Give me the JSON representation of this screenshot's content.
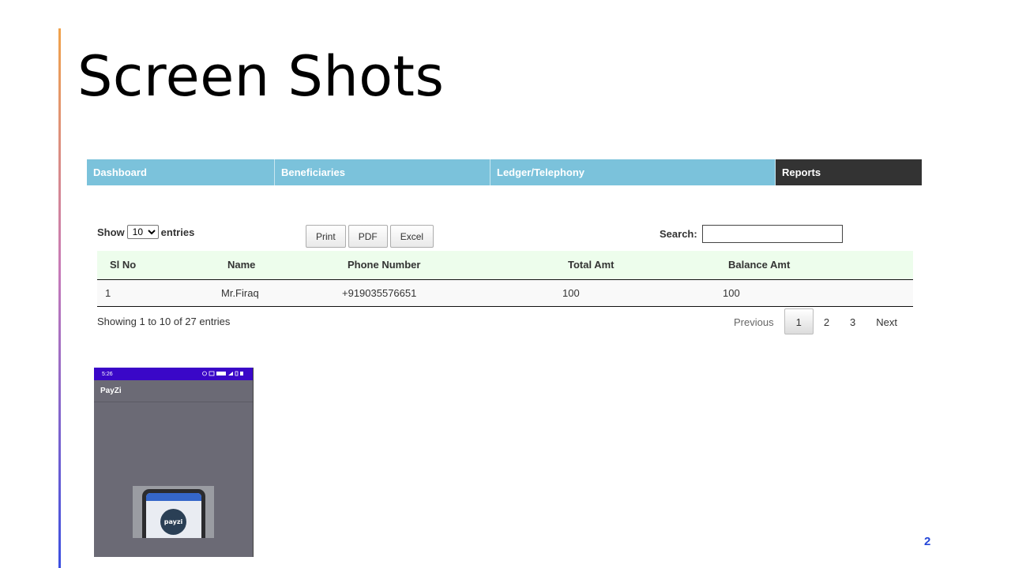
{
  "slide": {
    "title": "Screen Shots",
    "page_number": "2"
  },
  "nav": {
    "items": [
      {
        "label": "Dashboard",
        "active": false
      },
      {
        "label": "Beneficiaries",
        "active": false
      },
      {
        "label": "Ledger/Telephony",
        "active": false
      },
      {
        "label": "Reports",
        "active": true
      }
    ]
  },
  "table_controls": {
    "show_label": "Show",
    "entries_value": "10",
    "entries_label": "entries",
    "buttons": [
      "Print",
      "PDF",
      "Excel"
    ],
    "search_label": "Search:",
    "search_value": ""
  },
  "table": {
    "columns": [
      "Sl No",
      "Name",
      "Phone Number",
      "Total Amt",
      "Balance Amt"
    ],
    "rows": [
      [
        "1",
        "Mr.Firaq",
        "+919035576651",
        "100",
        "100"
      ]
    ]
  },
  "footer": {
    "info": "Showing 1 to 10 of 27 entries",
    "pagination": {
      "previous": "Previous",
      "pages": [
        "1",
        "2",
        "3"
      ],
      "current": "1",
      "next": "Next"
    }
  },
  "phone": {
    "status_time": "5:26",
    "app_title": "PayZi",
    "logo_text": "payzi"
  },
  "colors": {
    "nav_bg": "#7bc2db",
    "nav_active_bg": "#333333",
    "table_header_bg": "#edfdec",
    "phone_status_bg": "#3a07c8",
    "page_number": "#2446d8"
  }
}
